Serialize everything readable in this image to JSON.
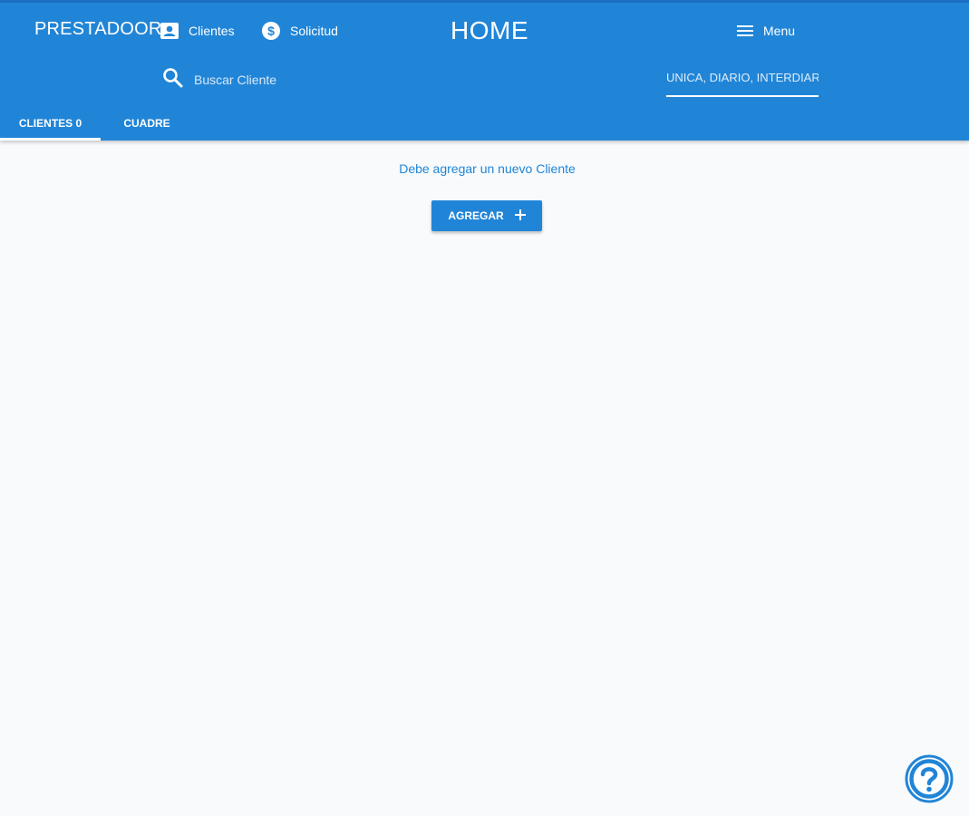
{
  "header": {
    "brand": "PRESTADOOR",
    "title": "HOME",
    "nav": {
      "clientes_label": "Clientes",
      "solicitud_label": "Solicitud",
      "menu_label": "Menu"
    },
    "search": {
      "placeholder": "Buscar Cliente"
    },
    "filter": {
      "value": "UNICA, DIARIO, INTERDIARIO"
    },
    "tabs": [
      {
        "label": "CLIENTES 0",
        "active": true
      },
      {
        "label": "CUADRE",
        "active": false
      }
    ]
  },
  "main": {
    "empty_message": "Debe agregar un nuevo Cliente",
    "add_button_label": "AGREGAR"
  },
  "icons": {
    "clientes": "contact-card-icon",
    "solicitud": "dollar-coin-icon",
    "menu": "hamburger-menu-icon",
    "search": "search-icon",
    "add": "plus-icon",
    "help": "help-circle-icon"
  },
  "colors": {
    "primary": "#2185d7",
    "background": "#f8fafc",
    "text_on_primary": "#ffffff"
  }
}
